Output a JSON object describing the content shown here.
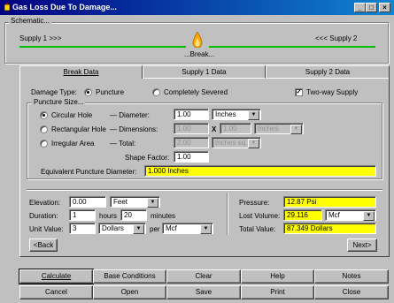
{
  "window": {
    "title": "Gas Loss Due To Damage..."
  },
  "schematic": {
    "group_label": "Schematic...",
    "left_label": "Supply 1 >>>",
    "right_label": "<<< Supply 2",
    "break_label": "...Break..."
  },
  "tabs": [
    {
      "label": "Break Data"
    },
    {
      "label": "Supply 1 Data"
    },
    {
      "label": "Supply 2 Data"
    }
  ],
  "damage": {
    "label": "Damage Type:",
    "options": [
      {
        "label": "Puncture",
        "selected": true
      },
      {
        "label": "Completely Severed",
        "selected": false
      }
    ],
    "two_way": {
      "label": "Two-way Supply",
      "checked": true
    }
  },
  "puncture": {
    "group_label": "Puncture Size...",
    "circular": {
      "label": "Circular Hole",
      "selected": true,
      "field_label": "— Diameter:",
      "value": "1.00",
      "unit": "Inches"
    },
    "rectangular": {
      "label": "Rectangular Hole",
      "selected": false,
      "field_label": "— Dimensions:",
      "value1": "1.00",
      "x": "X",
      "value2": "1.00",
      "unit": "Inches"
    },
    "irregular": {
      "label": "Irregular Area",
      "selected": false,
      "field_label": "— Total:",
      "value": "2.00",
      "unit": "Inches sq."
    },
    "shape_factor": {
      "label": "Shape Factor:",
      "value": "1.00"
    },
    "equivalent": {
      "label": "Equivalent Puncture Diameter:",
      "value": "1.000 Inches"
    }
  },
  "inputs": {
    "elevation": {
      "label": "Elevation:",
      "value": "0.00",
      "unit": "Feet"
    },
    "duration": {
      "label": "Duration:",
      "hours": "1",
      "hours_label": "hours",
      "minutes": "20",
      "minutes_label": "minutes"
    },
    "unit_value": {
      "label": "Unit Value:",
      "value": "3",
      "currency": "Dollars",
      "per_label": "per",
      "per_unit": "Mcf"
    }
  },
  "results": {
    "pressure": {
      "label": "Pressure:",
      "value": "12.87 Psi"
    },
    "lost_volume": {
      "label": "Lost Volume:",
      "value": "29.116",
      "unit": "Mcf"
    },
    "total_value": {
      "label": "Total Value:",
      "value": "87.349 Dollars"
    }
  },
  "nav": {
    "back": "<Back",
    "next": "Next>"
  },
  "buttons": {
    "row1": [
      "Calculate",
      "Base Conditions",
      "Clear",
      "Help",
      "Notes"
    ],
    "row2": [
      "Cancel",
      "Open",
      "Save",
      "Print",
      "Close"
    ]
  },
  "colors": {
    "accent_line": "#00c000",
    "highlight_field": "#ffff00",
    "titlebar": "#000080"
  },
  "icons": {
    "app": "gas-app-icon",
    "flame": "flame-icon"
  }
}
